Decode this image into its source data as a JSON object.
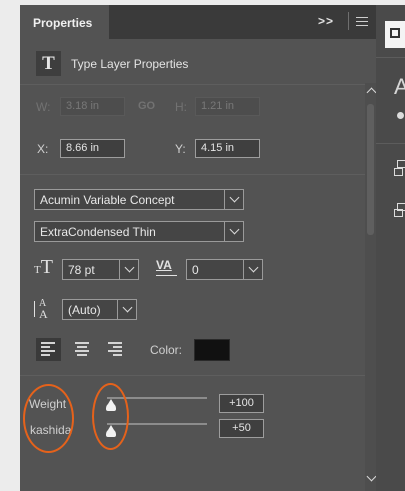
{
  "tabs": {
    "properties_label": "Properties",
    "collapse_glyph": ">>"
  },
  "header": {
    "icon_glyph": "T",
    "title": "Type Layer Properties"
  },
  "transform": {
    "w_label": "W:",
    "w_value": "3.18 in",
    "link_glyph": "GO",
    "h_label": "H:",
    "h_value": "1.21 in",
    "x_label": "X:",
    "x_value": "8.66 in",
    "y_label": "Y:",
    "y_value": "4.15 in"
  },
  "character": {
    "font_family": "Acumin Variable Concept",
    "font_style": "ExtraCondensed Thin",
    "size_value": "78 pt",
    "tracking_icon_text": "VA",
    "tracking_value": "0",
    "leading_value": "(Auto)",
    "color_label": "Color:",
    "color_swatch": "#111111"
  },
  "variable_axes": [
    {
      "label": "Weight",
      "value": "+100",
      "slider_fraction": 0.0
    },
    {
      "label": "kashida",
      "value": "+50",
      "slider_fraction": 0.0
    }
  ],
  "right_panel": {
    "big_letter": "A"
  },
  "colors": {
    "annotation_ring": "#e5621b",
    "panel_bg": "#535353"
  }
}
